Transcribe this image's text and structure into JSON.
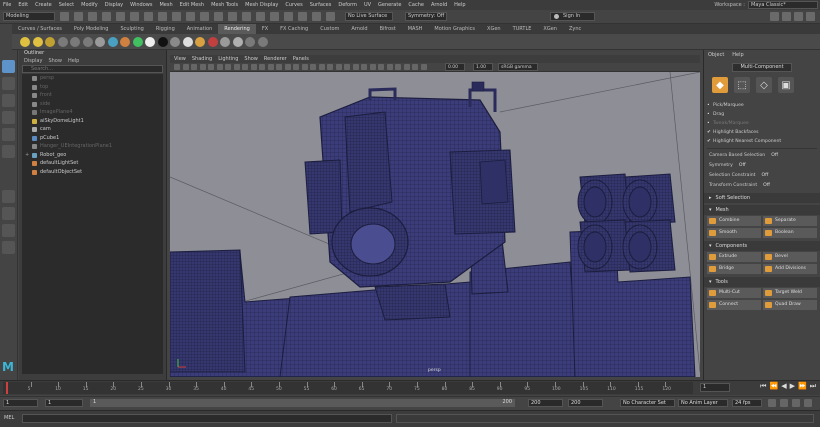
{
  "menubar": {
    "items": [
      "File",
      "Edit",
      "Create",
      "Select",
      "Modify",
      "Display",
      "Windows",
      "Mesh",
      "Edit Mesh",
      "Mesh Tools",
      "Mesh Display",
      "Curves",
      "Surfaces",
      "Deform",
      "UV",
      "Generate",
      "Cache",
      "Arnold",
      "Help"
    ],
    "workspace_label": "Workspace :",
    "workspace_value": "Maya Classic*"
  },
  "statusline": {
    "mode": "Modeling",
    "live_surface": "No Live Surface",
    "symmetry": "Symmetry: Off",
    "sign_in": "Sign In"
  },
  "shelf": {
    "tabs": [
      "Curves / Surfaces",
      "Poly Modeling",
      "Sculpting",
      "Rigging",
      "Animation",
      "Rendering",
      "FX",
      "FX Caching",
      "Custom",
      "Arnold",
      "Bifrost",
      "MASH",
      "Motion Graphics",
      "XGen",
      "TURTLE",
      "XGen",
      "Zync"
    ],
    "active_tab": "Rendering"
  },
  "outliner": {
    "title": "Outliner",
    "menu": [
      "Display",
      "Show",
      "Help"
    ],
    "search_placeholder": "Search...",
    "items": [
      {
        "label": "persp",
        "dim": true,
        "expand": ""
      },
      {
        "label": "top",
        "dim": true,
        "expand": ""
      },
      {
        "label": "front",
        "dim": true,
        "expand": ""
      },
      {
        "label": "side",
        "dim": true,
        "expand": ""
      },
      {
        "label": "ImagePlane4",
        "dim": true,
        "expand": ""
      },
      {
        "label": "aiSkyDomeLight1",
        "dim": false,
        "expand": ""
      },
      {
        "label": "cam",
        "dim": false,
        "expand": ""
      },
      {
        "label": "pCube1",
        "dim": false,
        "expand": ""
      },
      {
        "label": "Hanger_UEIntegrationPlane1",
        "dim": true,
        "expand": ""
      },
      {
        "label": "Robot_geo",
        "dim": false,
        "expand": "+"
      },
      {
        "label": "defaultLightSet",
        "dim": false,
        "expand": ""
      },
      {
        "label": "defaultObjectSet",
        "dim": false,
        "expand": ""
      }
    ]
  },
  "viewport": {
    "menu": [
      "View",
      "Shading",
      "Lighting",
      "Show",
      "Renderer",
      "Panels"
    ],
    "exposure": "0.00",
    "gamma": "1.00",
    "color_space": "sRGB gamma",
    "camera_label": "persp"
  },
  "modeling_toolkit": {
    "tabs": [
      "Object",
      "Help"
    ],
    "mode_button": "Multi-Component",
    "selection_options": [
      {
        "label": "Pick/Marquee",
        "checked": false,
        "dim": false
      },
      {
        "label": "Drag",
        "checked": false,
        "dim": false
      },
      {
        "label": "Tweak/Marquee",
        "checked": false,
        "dim": true
      },
      {
        "label": "Highlight Backfaces",
        "checked": true,
        "dim": false
      },
      {
        "label": "Highlight Nearest Component",
        "checked": true,
        "dim": false
      }
    ],
    "settings": [
      {
        "label": "Camera Based Selection",
        "value": "Off"
      },
      {
        "label": "Symmetry",
        "value": "Off"
      },
      {
        "label": "Selection Constraint",
        "value": "Off"
      },
      {
        "label": "Transform Constraint",
        "value": "Off"
      }
    ],
    "soft_selection": "Soft Selection",
    "sections": [
      {
        "title": "Mesh",
        "buttons": [
          "Combine",
          "Separate",
          "Smooth",
          "Boolean"
        ]
      },
      {
        "title": "Components",
        "buttons": [
          "Extrude",
          "Bevel",
          "Bridge",
          "Add Divisions"
        ]
      },
      {
        "title": "Tools",
        "buttons": [
          "Multi-Cut",
          "Target Weld",
          "Connect",
          "Quad Draw"
        ]
      }
    ]
  },
  "timeslider": {
    "ticks": [
      "5",
      "10",
      "15",
      "20",
      "25",
      "30",
      "35",
      "40",
      "45",
      "50",
      "55",
      "60",
      "65",
      "70",
      "75",
      "80",
      "85",
      "90",
      "95",
      "100",
      "105",
      "110",
      "115",
      "120"
    ],
    "current_frame": "1"
  },
  "range": {
    "start": "1",
    "playback_start": "1",
    "range_current": "1",
    "range_end_marker": "200",
    "playback_end": "200",
    "end": "200",
    "character_set": "No Character Set",
    "anim_layer": "No Anim Layer",
    "fps": "24 fps"
  },
  "cmdline": {
    "label": "MEL"
  },
  "colors": {
    "accent": "#5d93c9",
    "mesh_fill": "#3b3d7a",
    "mesh_edge": "#1c1d3e",
    "viewport_bg": "#8e8e96",
    "tool_orange": "#e09b3a"
  }
}
